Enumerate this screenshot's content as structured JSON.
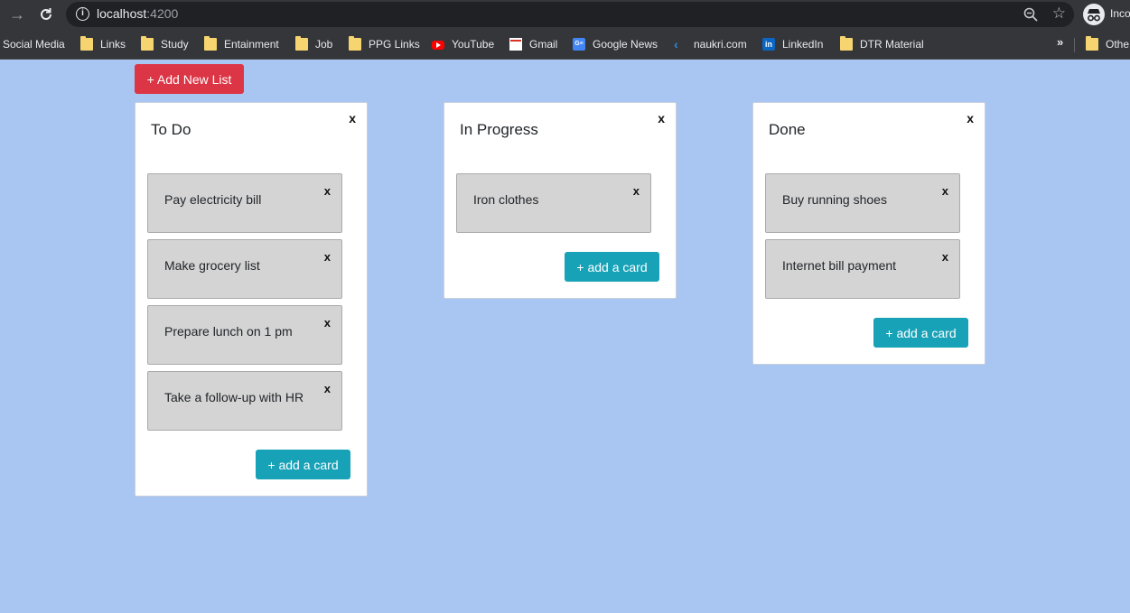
{
  "browser": {
    "url_host": "localhost",
    "url_port": ":4200",
    "profile_label": "Inco",
    "bookmarks": [
      {
        "label": "Social Media",
        "icon": "none"
      },
      {
        "label": "Links",
        "icon": "folder-icon"
      },
      {
        "label": "Study",
        "icon": "folder-icon"
      },
      {
        "label": "Entainment",
        "icon": "folder-icon"
      },
      {
        "label": "Job",
        "icon": "folder-icon"
      },
      {
        "label": "PPG Links",
        "icon": "folder-icon"
      },
      {
        "label": "YouTube",
        "icon": "youtube-icon"
      },
      {
        "label": "Gmail",
        "icon": "gmail-icon"
      },
      {
        "label": "Google News",
        "icon": "google-news-icon"
      },
      {
        "label": "naukri.com",
        "icon": "naukri-icon"
      },
      {
        "label": "LinkedIn",
        "icon": "linkedin-icon"
      },
      {
        "label": "DTR Material",
        "icon": "folder-icon"
      }
    ],
    "overflow_chevron": "»",
    "other_bookmarks": "Othe"
  },
  "app": {
    "add_list_label": "+ Add New List",
    "close_symbol": "x",
    "add_card_label": "+ add a card",
    "lists": [
      {
        "title": "To Do",
        "cards": [
          "Pay electricity bill",
          "Make grocery list",
          "Prepare lunch on 1 pm",
          "Take a follow-up with HR"
        ]
      },
      {
        "title": "In Progress",
        "cards": [
          "Iron clothes"
        ]
      },
      {
        "title": "Done",
        "cards": [
          "Buy running shoes",
          "Internet bill payment"
        ]
      }
    ]
  },
  "colors": {
    "page_background": "#a9c6f2",
    "add_list_button": "#dc3545",
    "add_card_button": "#17a2b8",
    "card_background": "#d4d4d4"
  }
}
